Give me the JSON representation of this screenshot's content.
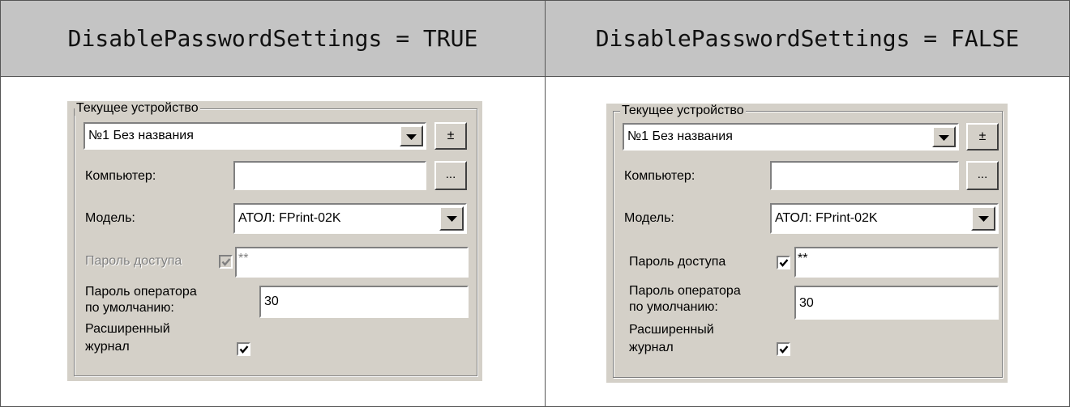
{
  "columns": [
    {
      "header": "DisablePasswordSettings = TRUE",
      "group_title": "Текущее устройство",
      "device_select": "№1 Без названия",
      "plusminus_label": "±",
      "computer_label": "Компьютер:",
      "computer_value": "",
      "browse_label": "...",
      "model_label": "Модель:",
      "model_select": "АТОЛ: FPrint-02K",
      "access_password_label": "Пароль доступа",
      "access_password_value": "**",
      "access_password_checked": true,
      "access_password_enabled": false,
      "operator_password_label_1": "Пароль оператора",
      "operator_password_label_2": "по умолчанию:",
      "operator_password_value": "30",
      "extended_log_label_1": "Расширенный",
      "extended_log_label_2": "журнал",
      "extended_log_checked": true
    },
    {
      "header": "DisablePasswordSettings = FALSE",
      "group_title": "Текущее устройство",
      "device_select": "№1 Без названия",
      "plusminus_label": "±",
      "computer_label": "Компьютер:",
      "computer_value": "",
      "browse_label": "...",
      "model_label": "Модель:",
      "model_select": "АТОЛ: FPrint-02K",
      "access_password_label": "Пароль доступа",
      "access_password_value": "**",
      "access_password_checked": true,
      "access_password_enabled": true,
      "operator_password_label_1": "Пароль оператора",
      "operator_password_label_2": "по умолчанию:",
      "operator_password_value": "30",
      "extended_log_label_1": "Расширенный",
      "extended_log_label_2": "журнал",
      "extended_log_checked": true
    }
  ],
  "colors": {
    "header_bg": "#c4c4c4",
    "panel_bg": "#d4d0c8",
    "disabled_text": "#808080"
  },
  "icons": {
    "dropdown": "triangle-down-icon",
    "checkbox": "checkmark-icon"
  }
}
